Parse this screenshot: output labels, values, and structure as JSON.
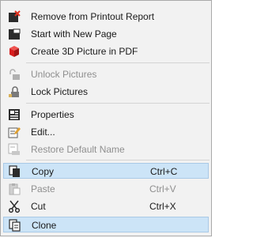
{
  "menu": {
    "items": [
      {
        "label": "Remove from Printout Report",
        "icon": "remove-from-report-icon"
      },
      {
        "label": "Start with New Page",
        "icon": "new-page-icon"
      },
      {
        "label": "Create 3D Picture in PDF",
        "icon": "cube-3d-icon"
      },
      {
        "label": "Unlock Pictures",
        "icon": "unlock-icon"
      },
      {
        "label": "Lock Pictures",
        "icon": "lock-icon"
      },
      {
        "label": "Properties",
        "icon": "properties-icon"
      },
      {
        "label": "Edit...",
        "icon": "edit-icon"
      },
      {
        "label": "Restore Default Name",
        "icon": "restore-name-icon"
      },
      {
        "label": "Copy",
        "shortcut": "Ctrl+C",
        "icon": "copy-icon"
      },
      {
        "label": "Paste",
        "shortcut": "Ctrl+V",
        "icon": "paste-icon"
      },
      {
        "label": "Cut",
        "shortcut": "Ctrl+X",
        "icon": "scissors-icon"
      },
      {
        "label": "Clone",
        "icon": "clone-icon"
      }
    ]
  },
  "colors": {
    "highlight": "#cce4f7",
    "highlight_border": "#a9c9e6",
    "disabled_text": "#8f8f8f",
    "remove_icon_red": "#e0301e",
    "cube_red": "#d81e1e"
  }
}
